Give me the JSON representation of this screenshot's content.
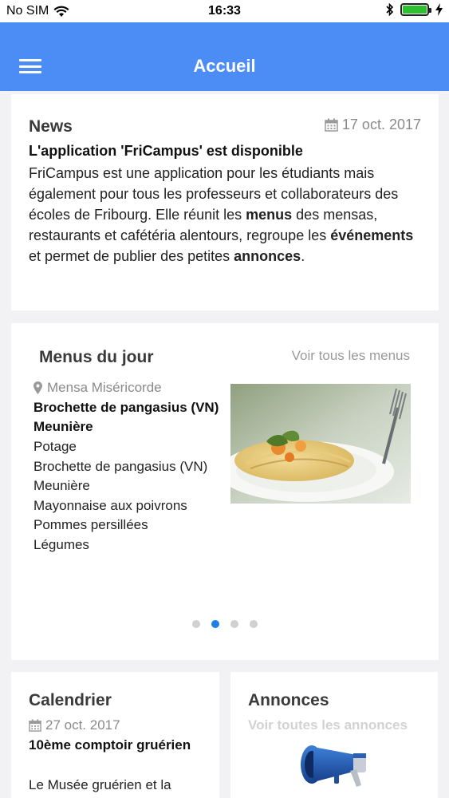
{
  "status_bar": {
    "carrier": "No SIM",
    "time": "16:33",
    "battery_level": 1.0
  },
  "navbar": {
    "title": "Accueil"
  },
  "news": {
    "heading": "News",
    "date": "17 oct. 2017",
    "subtitle": "L'application 'FriCampus' est disponible",
    "body_parts": {
      "p1": "FriCampus est une application pour les étudiants mais également pour tous les professeurs et collaborateurs des écoles de Fribourg. Elle réunit les ",
      "b1": "menus",
      "p2": " des mensas, restaurants et cafétéria alentours, regroupe les ",
      "b2": "événements",
      "p3": " et permet de publier des petites ",
      "b3": "annonces",
      "p4": "."
    }
  },
  "menus": {
    "heading": "Menus du jour",
    "see_all": "Voir tous les menus",
    "location": "Mensa Miséricorde",
    "dish_title": "Brochette de pangasius (VN) Meunière",
    "items": [
      "Potage",
      "Brochette de pangasius (VN) Meunière",
      "Mayonnaise aux poivrons",
      "Pommes persillées",
      "Légumes"
    ],
    "pagination": {
      "count": 4,
      "active_index": 1
    }
  },
  "calendar": {
    "heading": "Calendrier",
    "date": "27 oct. 2017",
    "title": "10ème comptoir gruérien",
    "body": "Le Musée gruérien et la"
  },
  "annonces": {
    "heading": "Annonces",
    "see_all": "Voir toutes les annonces"
  },
  "colors": {
    "navbar": "#4b8cf5",
    "active_dot": "#1e7fe6",
    "battery": "#2ec02e"
  }
}
